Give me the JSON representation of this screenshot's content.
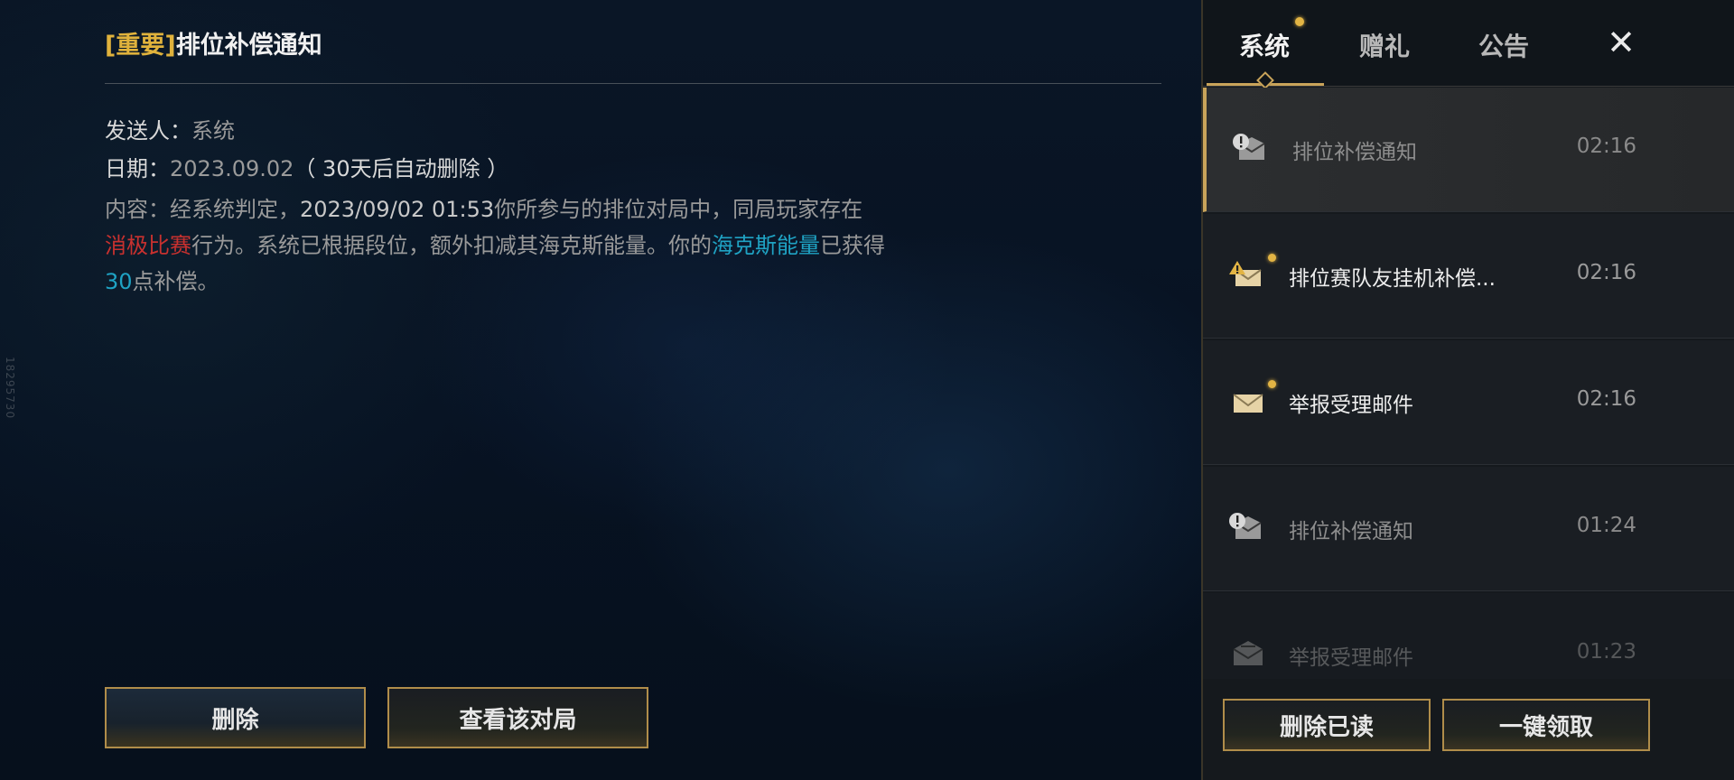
{
  "side_id": "18295730",
  "detail": {
    "title_tag": "[重要]",
    "title_text": "排位补偿通知",
    "sender_label": "发送人：",
    "sender_value": "系统",
    "date_label": "日期：",
    "date_value": "2023.09.02",
    "date_note": "（ 30天后自动删除 ）",
    "content": {
      "p1": "内容：经系统判定，",
      "p2": "2023/09/02 01:53",
      "p3": "你所参与的排位对局中，同局玩家存在",
      "p4": "消极比赛",
      "p5": "行为。系统已根据段位，额外扣减其海克斯能量。你的",
      "p6": "海克斯能量",
      "p7": "已获得",
      "p8": "30",
      "p9": "点补偿。"
    },
    "delete_label": "删除",
    "view_match_label": "查看该对局"
  },
  "panel": {
    "tabs": [
      {
        "label": "系统",
        "active": true,
        "has_dot": true
      },
      {
        "label": "赠礼",
        "active": false,
        "has_dot": false
      },
      {
        "label": "公告",
        "active": false,
        "has_dot": false
      }
    ],
    "close_label": "✕",
    "mails": [
      {
        "subject": "排位补偿通知",
        "time": "02:16",
        "icon": "important-mail-read-icon",
        "unread": false,
        "selected": true
      },
      {
        "subject": "排位赛队友挂机补偿...",
        "time": "02:16",
        "icon": "important-mail-unread-icon",
        "unread": true,
        "selected": false
      },
      {
        "subject": "举报受理邮件",
        "time": "02:16",
        "icon": "mail-unread-icon",
        "unread": true,
        "selected": false
      },
      {
        "subject": "排位补偿通知",
        "time": "01:24",
        "icon": "important-mail-read-icon",
        "unread": false,
        "selected": false
      },
      {
        "subject": "举报受理邮件",
        "time": "01:23",
        "icon": "mail-read-icon",
        "unread": false,
        "selected": false
      }
    ],
    "delete_read_label": "删除已读",
    "claim_all_label": "一键领取"
  },
  "colors": {
    "gold_accent": "#c9a45a",
    "title_tag": "#e0b23c",
    "warning_red": "#c8312f",
    "hextech_teal": "#1fa3c4",
    "unread_dot": "#e2b444"
  }
}
